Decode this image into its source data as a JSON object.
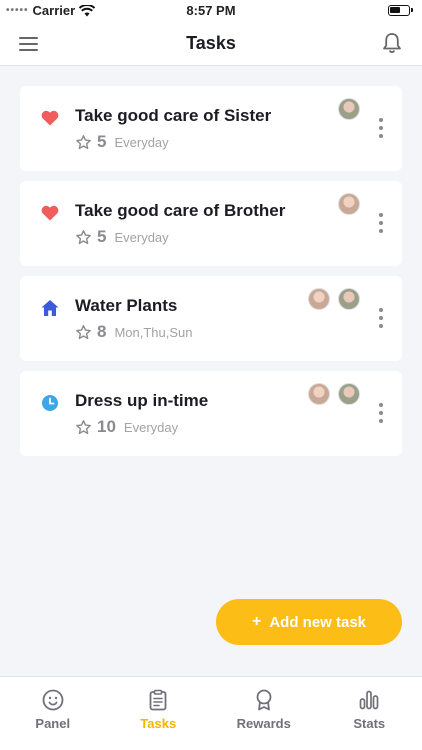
{
  "status_bar": {
    "carrier": "Carrier",
    "time": "8:57 PM",
    "signal_dots": "•••••"
  },
  "header": {
    "title": "Tasks"
  },
  "tasks": [
    {
      "title": "Take good care of Sister",
      "points": "5",
      "schedule": "Everyday",
      "icon": "heart-icon",
      "avatars": 1
    },
    {
      "title": "Take good care of Brother",
      "points": "5",
      "schedule": "Everyday",
      "icon": "heart-icon",
      "avatars": 1
    },
    {
      "title": "Water Plants",
      "points": "8",
      "schedule": "Mon,Thu,Sun",
      "icon": "house-icon",
      "avatars": 2
    },
    {
      "title": "Dress up in-time",
      "points": "10",
      "schedule": "Everyday",
      "icon": "clock-icon",
      "avatars": 2
    }
  ],
  "add_button": {
    "plus": "+",
    "label": "Add new task"
  },
  "tab_bar": {
    "tabs": [
      {
        "label": "Panel",
        "icon": "smiley-icon",
        "active": false
      },
      {
        "label": "Tasks",
        "icon": "clipboard-icon",
        "active": true
      },
      {
        "label": "Rewards",
        "icon": "medal-icon",
        "active": false
      },
      {
        "label": "Stats",
        "icon": "bar-chart-icon",
        "active": false
      }
    ]
  },
  "colors": {
    "accent": "#fbbd16",
    "heart": "#f25c5c",
    "house": "#3b5bdb",
    "clock": "#3aa8e8",
    "background": "#f4f5f8"
  }
}
